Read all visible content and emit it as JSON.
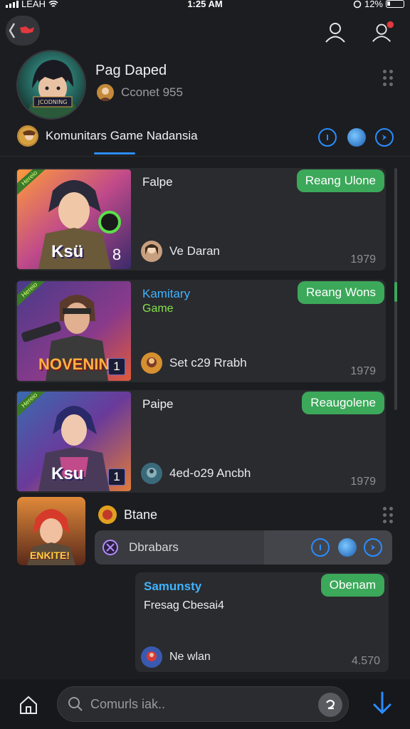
{
  "status_bar": {
    "carrier": "LEAH",
    "time": "1:25 AM",
    "battery": "12%"
  },
  "profile": {
    "name": "Pag Daped",
    "subtitle": "Cconet 955",
    "avatar_label": "JCODNING"
  },
  "community": {
    "title": "Komunitars Game Nadansia"
  },
  "cards": [
    {
      "title": "Falpe",
      "subtitle": "",
      "action": "Reang Ulone",
      "author": "Ve Daran",
      "year": "1979",
      "thumb_label": "Ksü",
      "badge": "8",
      "corner": "Hereio"
    },
    {
      "title": "Kamitary",
      "subtitle": "Game",
      "action": "Reang Wons",
      "author": "Set c29 Rrabh",
      "year": "1979",
      "thumb_label": "NOVENIN",
      "badge": "1",
      "corner": "Hereio"
    },
    {
      "title": "Paipe",
      "subtitle": "",
      "action": "Reaugolene",
      "author": "4ed-o29 Ancbh",
      "year": "1979",
      "thumb_label": "Ksu",
      "badge": "1",
      "corner": "Hereio"
    }
  ],
  "lower": {
    "name": "Btane",
    "thumb_label": "ENKITE!",
    "search_label": "Dbrabars"
  },
  "message": {
    "title": "Samunsty",
    "text": "Fresag Cbesai4",
    "action": "Obenam",
    "author": "Ne wlan",
    "count": "4.570"
  },
  "bottom": {
    "placeholder": "Comurls iak.."
  },
  "colors": {
    "accent": "#2a8cff",
    "green": "#3ca85a",
    "bg": "#1c1d20"
  },
  "icons": [
    "back-icon",
    "profile-icon",
    "notification-profile-icon",
    "menu-dots-icon",
    "home-icon",
    "search-icon",
    "send-icon",
    "download-icon"
  ]
}
